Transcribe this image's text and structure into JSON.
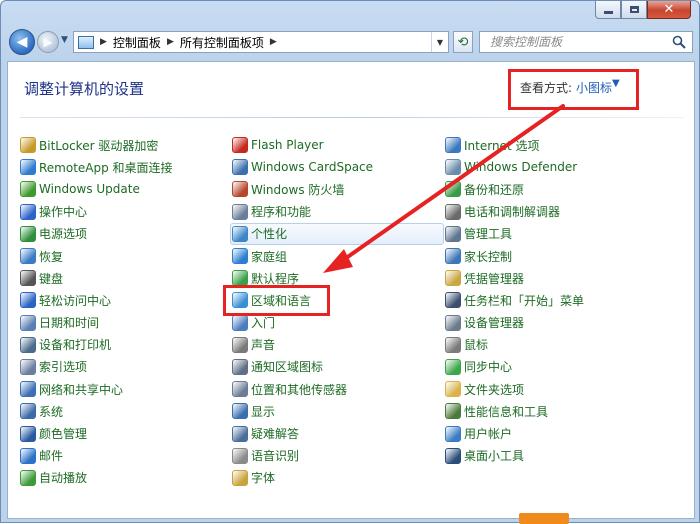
{
  "window": {
    "caption_buttons": [
      "minimize",
      "maximize",
      "close"
    ],
    "close_glyph": "✕"
  },
  "navigation": {
    "back_glyph": "◀",
    "forward_glyph": "▶",
    "breadcrumb": [
      "控制面板",
      "所有控制面板项"
    ],
    "separator": "▶",
    "search_placeholder": "搜索控制面板"
  },
  "header": {
    "title": "调整计算机的设置",
    "view_label": "查看方式:",
    "view_value": "小图标",
    "caret": "▼"
  },
  "columns": [
    [
      {
        "label": "BitLocker 驱动器加密",
        "icon": "bitlocker-icon",
        "color": "#c89a2a"
      },
      {
        "label": "RemoteApp 和桌面连接",
        "icon": "remoteapp-icon",
        "color": "#2f7bd0"
      },
      {
        "label": "Windows Update",
        "icon": "windows-update-icon",
        "color": "#3e9b2f"
      },
      {
        "label": "操作中心",
        "icon": "action-center-flag-icon",
        "color": "#2d62c9"
      },
      {
        "label": "电源选项",
        "icon": "power-options-icon",
        "color": "#2f8f3a"
      },
      {
        "label": "恢复",
        "icon": "recovery-icon",
        "color": "#3a7bc4"
      },
      {
        "label": "键盘",
        "icon": "keyboard-icon",
        "color": "#555555"
      },
      {
        "label": "轻松访问中心",
        "icon": "ease-of-access-icon",
        "color": "#2a64c2"
      },
      {
        "label": "日期和时间",
        "icon": "date-time-icon",
        "color": "#5a7fb3"
      },
      {
        "label": "设备和打印机",
        "icon": "devices-printers-icon",
        "color": "#4a6b8c"
      },
      {
        "label": "索引选项",
        "icon": "indexing-icon",
        "color": "#6a7ea0"
      },
      {
        "label": "网络和共享中心",
        "icon": "network-sharing-icon",
        "color": "#3c6fb7"
      },
      {
        "label": "系统",
        "icon": "system-icon",
        "color": "#3a6aa8"
      },
      {
        "label": "颜色管理",
        "icon": "color-management-icon",
        "color": "#2a5aa0"
      },
      {
        "label": "邮件",
        "icon": "mail-icon",
        "color": "#2b72c8"
      },
      {
        "label": "自动播放",
        "icon": "autoplay-icon",
        "color": "#3d9a3a"
      }
    ],
    [
      {
        "label": "Flash Player",
        "icon": "flash-player-icon",
        "color": "#c6281f"
      },
      {
        "label": "Windows CardSpace",
        "icon": "cardspace-icon",
        "color": "#3b6fb0"
      },
      {
        "label": "Windows 防火墙",
        "icon": "firewall-icon",
        "color": "#b5482c"
      },
      {
        "label": "程序和功能",
        "icon": "programs-features-icon",
        "color": "#6b7d99"
      },
      {
        "label": "个性化",
        "icon": "personalization-icon",
        "color": "#3b86c9"
      },
      {
        "label": "家庭组",
        "icon": "homegroup-icon",
        "color": "#2c7fd0"
      },
      {
        "label": "默认程序",
        "icon": "default-programs-icon",
        "color": "#38a046"
      },
      {
        "label": "区域和语言",
        "icon": "region-language-icon",
        "color": "#3a8fd4"
      },
      {
        "label": "入门",
        "icon": "getting-started-icon",
        "color": "#4b7bc0"
      },
      {
        "label": "声音",
        "icon": "sound-icon",
        "color": "#7a7a7a"
      },
      {
        "label": "通知区域图标",
        "icon": "notification-area-icon",
        "color": "#5f6f86"
      },
      {
        "label": "位置和其他传感器",
        "icon": "location-sensors-icon",
        "color": "#6a7d96"
      },
      {
        "label": "显示",
        "icon": "display-icon",
        "color": "#3a6fae"
      },
      {
        "label": "疑难解答",
        "icon": "troubleshooting-icon",
        "color": "#4a6d9a"
      },
      {
        "label": "语音识别",
        "icon": "speech-recognition-icon",
        "color": "#8a8a8a"
      },
      {
        "label": "字体",
        "icon": "fonts-icon",
        "color": "#c8a23a"
      }
    ],
    [
      {
        "label": "Internet 选项",
        "icon": "internet-options-icon",
        "color": "#3a78c0"
      },
      {
        "label": "Windows Defender",
        "icon": "defender-icon",
        "color": "#6b8cad"
      },
      {
        "label": "备份和还原",
        "icon": "backup-restore-icon",
        "color": "#3a9a46"
      },
      {
        "label": "电话和调制解调器",
        "icon": "phone-modem-icon",
        "color": "#6a6a6a"
      },
      {
        "label": "管理工具",
        "icon": "admin-tools-icon",
        "color": "#5e7690"
      },
      {
        "label": "家长控制",
        "icon": "parental-controls-icon",
        "color": "#3f76b9"
      },
      {
        "label": "凭据管理器",
        "icon": "credential-manager-icon",
        "color": "#c9a640"
      },
      {
        "label": "任务栏和「开始」菜单",
        "icon": "taskbar-start-icon",
        "color": "#3b4f70"
      },
      {
        "label": "设备管理器",
        "icon": "device-manager-icon",
        "color": "#6b7b8e"
      },
      {
        "label": "鼠标",
        "icon": "mouse-icon",
        "color": "#7a7a7a"
      },
      {
        "label": "同步中心",
        "icon": "sync-center-icon",
        "color": "#3da64a"
      },
      {
        "label": "文件夹选项",
        "icon": "folder-options-icon",
        "color": "#d9b24a"
      },
      {
        "label": "性能信息和工具",
        "icon": "performance-icon",
        "color": "#4c7a3a"
      },
      {
        "label": "用户帐户",
        "icon": "user-accounts-icon",
        "color": "#3b7cc4"
      },
      {
        "label": "桌面小工具",
        "icon": "desktop-gadgets-icon",
        "color": "#2a4e7a"
      }
    ]
  ],
  "colors": {
    "link_green": "#1d6b24",
    "title_blue": "#1e3287",
    "annotation_red": "#e52323"
  }
}
